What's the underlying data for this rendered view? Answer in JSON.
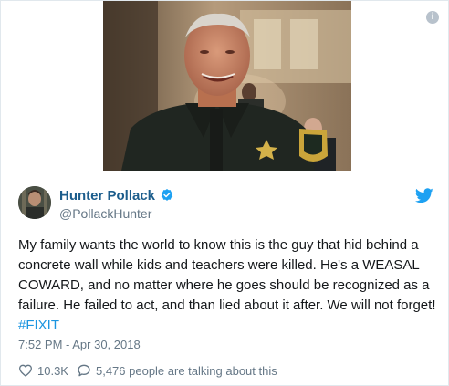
{
  "tweet": {
    "author": {
      "display_name": "Hunter Pollack",
      "handle": "@PollackHunter",
      "verified": true
    },
    "text_main": "My family wants the world to know this is the guy that hid behind a concrete wall while kids and teachers were killed. He's a WEASAL COWARD, and no matter where he goes should be recognized as a failure. He failed to act, and than lied about it after. We will not forget! ",
    "hashtag": "#FIXIT",
    "timestamp": "7:52 PM - Apr 30, 2018",
    "likes": "10.3K",
    "conversation": "5,476 people are talking about this"
  },
  "icons": {
    "info": "info-icon",
    "verified": "verified-badge-icon",
    "brand": "twitter-bird-icon",
    "like": "heart-icon",
    "reply": "speech-bubble-icon"
  },
  "colors": {
    "name": "#1c5d8c",
    "link": "#1b95e0",
    "muted": "#657786",
    "text": "#14171a",
    "twitter_blue": "#1da1f2"
  }
}
